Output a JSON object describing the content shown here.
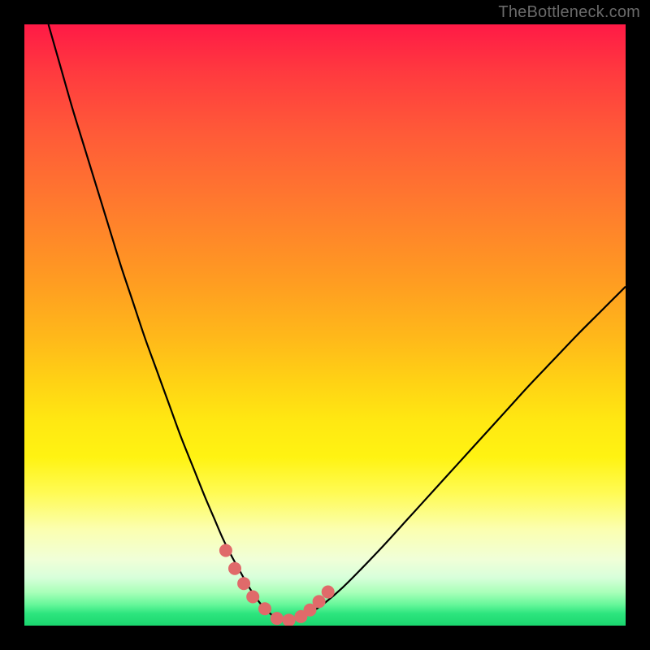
{
  "watermark": "TheBottleneck.com",
  "colors": {
    "frame": "#000000",
    "curve": "#000000",
    "marker_fill": "#e06a6a",
    "marker_stroke": "#d85f5f"
  },
  "chart_data": {
    "type": "line",
    "title": "",
    "xlabel": "",
    "ylabel": "",
    "xlim": [
      0,
      100
    ],
    "ylim": [
      0,
      100
    ],
    "grid": false,
    "series": [
      {
        "name": "bottleneck-curve",
        "x": [
          4,
          6,
          8,
          10,
          12,
          14,
          16,
          18,
          20,
          22,
          24,
          26,
          28,
          30,
          31.5,
          33,
          34.5,
          36,
          37,
          38,
          39,
          40,
          41,
          42,
          43,
          44,
          46,
          48,
          50,
          53,
          56,
          60,
          64,
          68,
          72,
          76,
          80,
          84,
          88,
          92,
          96,
          100
        ],
        "values": [
          100,
          93,
          86,
          79.5,
          73,
          66.5,
          60,
          54,
          48,
          42.5,
          37,
          31.5,
          26.5,
          21.5,
          18,
          14.5,
          11.5,
          8.8,
          7.0,
          5.4,
          4.0,
          2.8,
          1.9,
          1.2,
          0.8,
          0.9,
          1.4,
          2.4,
          3.8,
          6.4,
          9.4,
          13.6,
          18.0,
          22.4,
          26.8,
          31.2,
          35.6,
          40.0,
          44.2,
          48.4,
          52.4,
          56.4
        ]
      }
    ],
    "markers": {
      "name": "bottom-dots",
      "x": [
        33.5,
        35,
        36.5,
        38,
        40,
        42,
        44,
        46,
        47.5,
        49,
        50.5
      ],
      "values": [
        12.5,
        9.5,
        7.0,
        4.8,
        2.8,
        1.2,
        0.9,
        1.5,
        2.6,
        4.0,
        5.6
      ]
    }
  }
}
